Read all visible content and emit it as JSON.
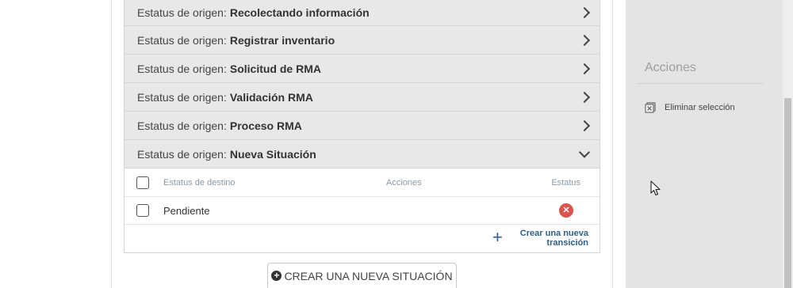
{
  "accordion": {
    "prefix": "Estatus de origen:",
    "rows": [
      {
        "value": "Recolectando información"
      },
      {
        "value": "Registrar inventario"
      },
      {
        "value": "Solicitud de RMA"
      },
      {
        "value": "Validación RMA"
      },
      {
        "value": "Proceso RMA"
      },
      {
        "value": "Nueva Situación"
      }
    ]
  },
  "table": {
    "headers": {
      "destino": "Estatus de destino",
      "acciones": "Acciones",
      "estatus": "Estatus"
    },
    "rows": [
      {
        "destino": "Pendiente",
        "estatus_icon": "error-x-icon"
      }
    ],
    "status_x_glyph": "✕",
    "create_transition": "Crear una nueva transición"
  },
  "new_situation_button": "CREAR UNA NUEVA SITUACIÓN",
  "sidebar": {
    "title": "Acciones",
    "delete_selection": "Eliminar selección"
  },
  "colors": {
    "accent": "#2f5f87",
    "error": "#d9534f",
    "panel_bg": "#e4e4e4"
  }
}
